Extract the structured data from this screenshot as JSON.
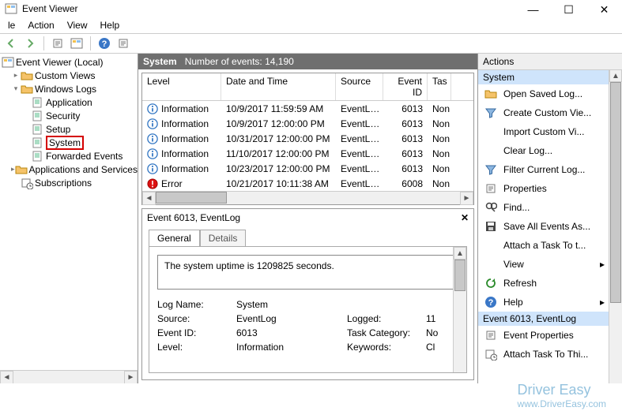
{
  "window": {
    "title": "Event Viewer"
  },
  "menu": [
    "le",
    "Action",
    "View",
    "Help"
  ],
  "tree": {
    "root": "Event Viewer (Local)",
    "items": [
      {
        "label": "Custom Views",
        "indent": 1,
        "icon": "folder",
        "twisty": "▸"
      },
      {
        "label": "Windows Logs",
        "indent": 1,
        "icon": "folder",
        "twisty": "▾"
      },
      {
        "label": "Application",
        "indent": 2,
        "icon": "log"
      },
      {
        "label": "Security",
        "indent": 2,
        "icon": "log"
      },
      {
        "label": "Setup",
        "indent": 2,
        "icon": "log"
      },
      {
        "label": "System",
        "indent": 2,
        "icon": "log",
        "hl": true
      },
      {
        "label": "Forwarded Events",
        "indent": 2,
        "icon": "log"
      },
      {
        "label": "Applications and Services Lo",
        "indent": 1,
        "icon": "folder",
        "twisty": "▸"
      },
      {
        "label": "Subscriptions",
        "indent": 1,
        "icon": "sub"
      }
    ]
  },
  "centerHeader": {
    "title": "System",
    "count_label": "Number of events: 14,190"
  },
  "columns": [
    "Level",
    "Date and Time",
    "Source",
    "Event ID",
    "Tas"
  ],
  "events": [
    {
      "level": "Information",
      "dt": "10/9/2017 11:59:59 AM",
      "src": "EventL…",
      "eid": "6013",
      "tc": "Non"
    },
    {
      "level": "Information",
      "dt": "10/9/2017 12:00:00 PM",
      "src": "EventL…",
      "eid": "6013",
      "tc": "Non"
    },
    {
      "level": "Information",
      "dt": "10/31/2017 12:00:00 PM",
      "src": "EventL…",
      "eid": "6013",
      "tc": "Non"
    },
    {
      "level": "Information",
      "dt": "11/10/2017 12:00:00 PM",
      "src": "EventL…",
      "eid": "6013",
      "tc": "Non"
    },
    {
      "level": "Information",
      "dt": "10/23/2017 12:00:00 PM",
      "src": "EventL…",
      "eid": "6013",
      "tc": "Non"
    },
    {
      "level": "Error",
      "dt": "10/21/2017 10:11:38 AM",
      "src": "EventL…",
      "eid": "6008",
      "tc": "Non"
    }
  ],
  "preview": {
    "title": "Event 6013, EventLog",
    "tabs": [
      "General",
      "Details"
    ],
    "message": "The system uptime is 1209825 seconds.",
    "props": {
      "logname_k": "Log Name:",
      "logname_v": "System",
      "source_k": "Source:",
      "source_v": "EventLog",
      "logged_k": "Logged:",
      "logged_v": "11",
      "eid_k": "Event ID:",
      "eid_v": "6013",
      "cat_k": "Task Category:",
      "cat_v": "No",
      "lvl_k": "Level:",
      "lvl_v": "Information",
      "kw_k": "Keywords:",
      "kw_v": "Cl"
    }
  },
  "actions": {
    "header": "Actions",
    "sec1": "System",
    "links1": [
      {
        "label": "Open Saved Log...",
        "icon": "folder"
      },
      {
        "label": "Create Custom Vie...",
        "icon": "funnel"
      },
      {
        "label": "Import Custom Vi...",
        "icon": "blank"
      },
      {
        "label": "Clear Log...",
        "icon": "blank"
      },
      {
        "label": "Filter Current Log...",
        "icon": "funnel"
      },
      {
        "label": "Properties",
        "icon": "props"
      },
      {
        "label": "Find...",
        "icon": "find"
      },
      {
        "label": "Save All Events As...",
        "icon": "save"
      },
      {
        "label": "Attach a Task To t...",
        "icon": "blank"
      },
      {
        "label": "View",
        "icon": "blank",
        "arrow": true
      },
      {
        "label": "Refresh",
        "icon": "refresh"
      },
      {
        "label": "Help",
        "icon": "help",
        "arrow": true
      }
    ],
    "sec2": "Event 6013, EventLog",
    "links2": [
      {
        "label": "Event Properties",
        "icon": "props"
      },
      {
        "label": "Attach Task To Thi...",
        "icon": "task"
      }
    ]
  },
  "watermark": {
    "brand": "Driver Easy",
    "url": "www.DriverEasy.com"
  }
}
